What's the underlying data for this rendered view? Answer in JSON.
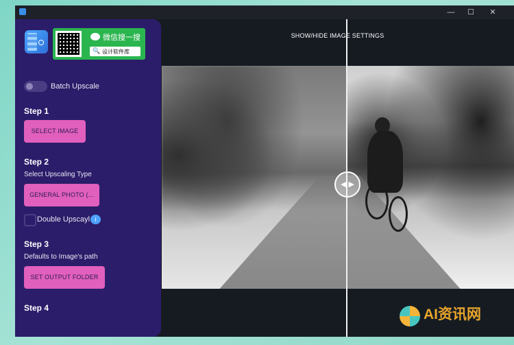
{
  "window": {
    "title": ""
  },
  "sidebar": {
    "wechat": {
      "title": "微信搜一搜",
      "search_text": "设计软件库"
    },
    "batch_upscale_label": "Batch Upscale",
    "step1": {
      "title": "Step 1",
      "button": "SELECT IMAGE"
    },
    "step2": {
      "title": "Step 2",
      "subtitle": "Select Upscaling Type",
      "button": "GENERAL PHOTO (...",
      "double_label": "Double Upscayl",
      "info": "i"
    },
    "step3": {
      "title": "Step 3",
      "subtitle": "Defaults to Image's path",
      "button": "SET OUTPUT FOLDER"
    },
    "step4": {
      "title": "Step 4"
    }
  },
  "preview": {
    "settings_link": "SHOW/HIDE IMAGE SETTINGS",
    "handle_glyph": "◀ ▶"
  },
  "watermark": {
    "text": "AI资讯网"
  },
  "colors": {
    "sidebar": "#2c1d6a",
    "accent_button": "#e15fbd",
    "wechat_green": "#2bb54f"
  },
  "controls": {
    "batch_upscale": false,
    "double_upscayl": false
  }
}
